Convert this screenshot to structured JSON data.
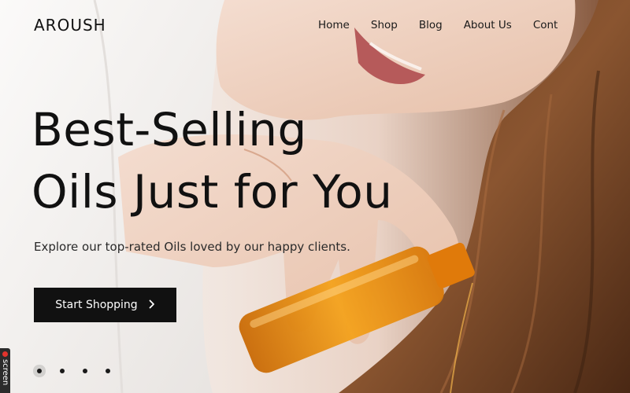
{
  "brand": {
    "logo": "AROUSH"
  },
  "nav": {
    "items": [
      "Home",
      "Shop",
      "Blog",
      "About Us",
      "Cont"
    ]
  },
  "hero": {
    "headline_line1": "Best-Selling",
    "headline_line2": "Oils Just for You",
    "subtitle": "Explore our top-rated Oils loved by our happy clients.",
    "cta_label": "Start Shopping",
    "cta_icon": "chevron-right-icon",
    "slides_count": 4,
    "active_slide": 1
  },
  "recorder": {
    "label": "screen",
    "indicator_color": "#e2342d"
  },
  "colors": {
    "text": "#111111",
    "cta_bg": "#111111",
    "cta_text": "#ffffff",
    "oil": "#e8890f"
  }
}
